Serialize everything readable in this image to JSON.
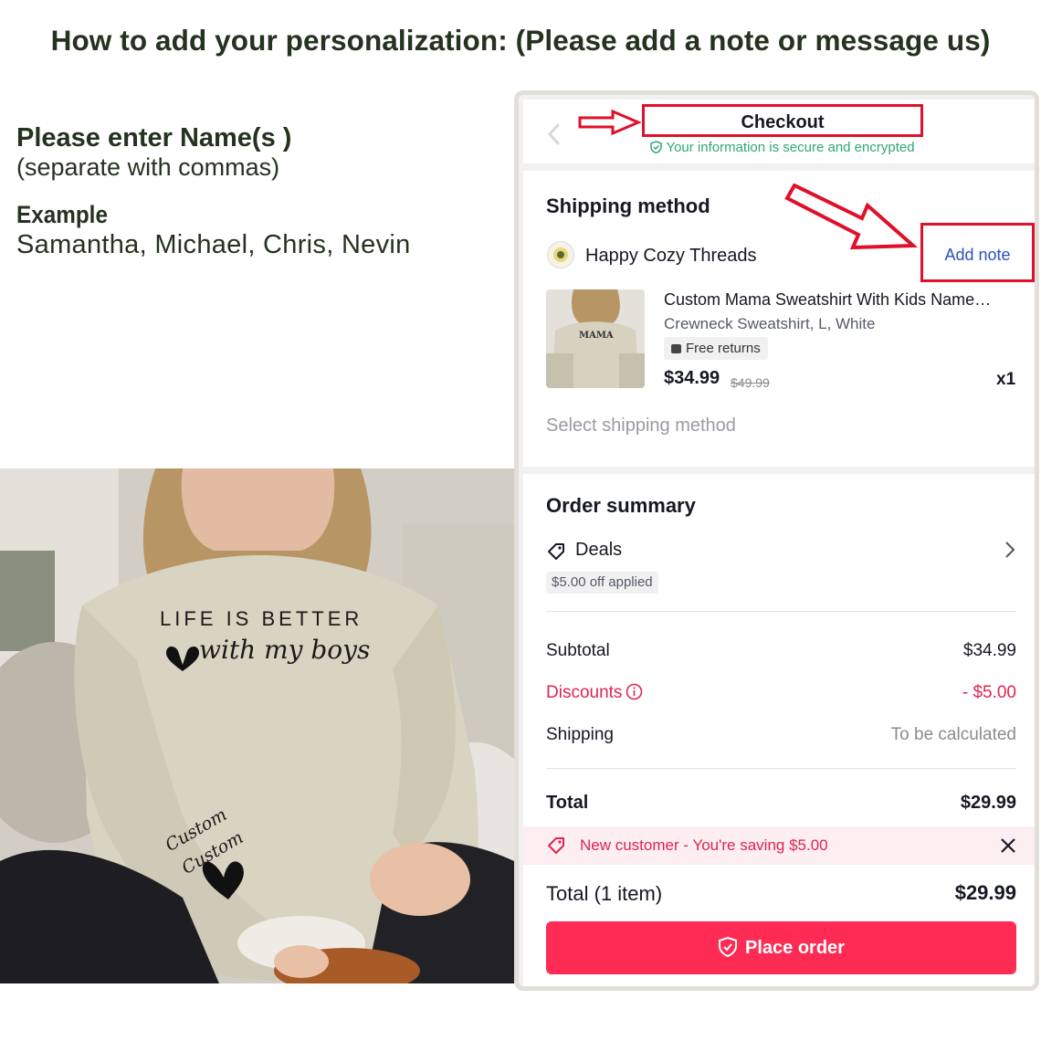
{
  "headline": "How to add your personalization: (Please add a note or message us)",
  "instructions": {
    "line1": "Please enter Name(s )",
    "line2": "(separate with commas)",
    "example_label": "Example",
    "example_value": "Samantha, Michael, Chris, Nevin"
  },
  "photo": {
    "print_line1": "LIFE IS BETTER",
    "print_line2": "with my boys",
    "sleeve_line1": "Custom",
    "sleeve_line2": "Custom"
  },
  "checkout": {
    "title": "Checkout",
    "secure_text": "Your information is secure and encrypted",
    "shipping": {
      "title": "Shipping method",
      "shop_name": "Happy Cozy Threads",
      "add_note": "Add note",
      "product": {
        "name": "Custom Mama Sweatshirt With Kids Name…",
        "variant": "Crewneck Sweatshirt, L, White",
        "returns": "Free returns",
        "price": "$34.99",
        "old_price": "$49.99",
        "quantity": "x1",
        "thumb_text": "MAMA"
      },
      "select_method": "Select shipping method"
    },
    "summary": {
      "title": "Order summary",
      "deals_label": "Deals",
      "deals_applied": "$5.00 off applied",
      "subtotal_label": "Subtotal",
      "subtotal_value": "$34.99",
      "discounts_label": "Discounts",
      "discounts_value": "- $5.00",
      "shipping_label": "Shipping",
      "shipping_value": "To be calculated",
      "total_label": "Total",
      "total_value": "$29.99"
    },
    "promo": "New customer - You're saving $5.00",
    "footer": {
      "total_label": "Total",
      "item_count": "(1 item)",
      "total_value": "$29.99",
      "place_order": "Place order"
    }
  },
  "colors": {
    "headline": "#24331f",
    "accent_red": "#fe2c55",
    "discount_red": "#e0244f",
    "annotation_red": "#e0102a",
    "secure_green": "#2fa874",
    "link_blue": "#2a52be"
  }
}
